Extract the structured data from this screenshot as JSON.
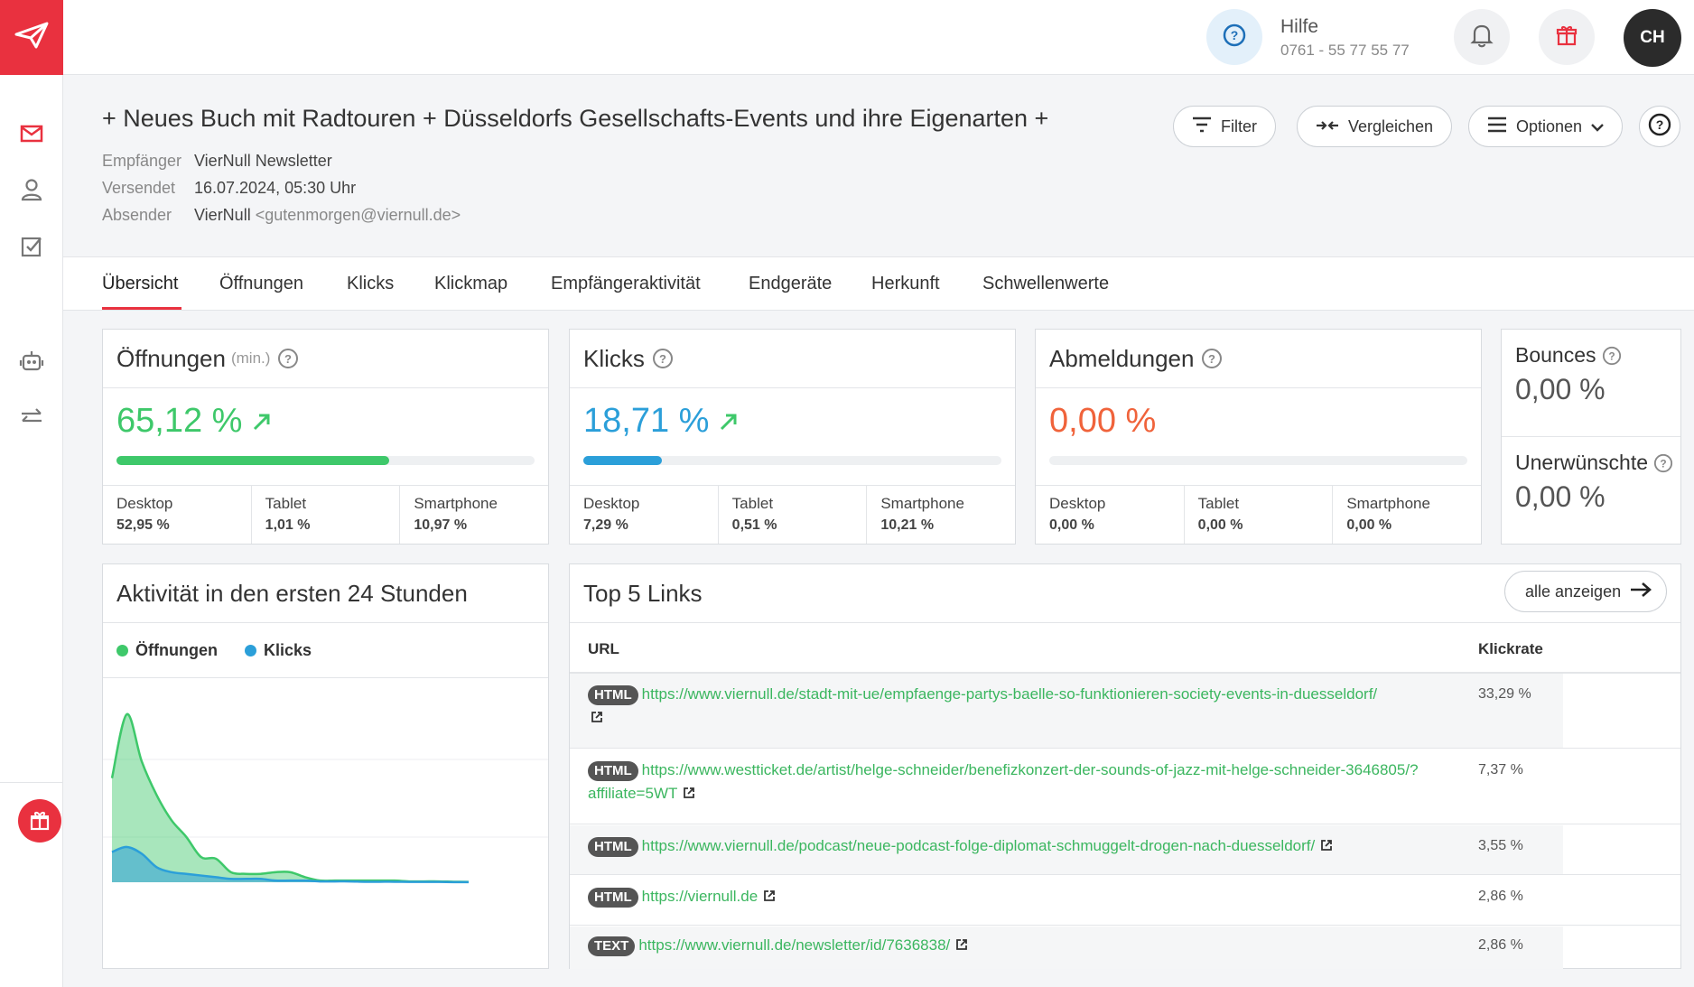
{
  "topbar": {
    "help_title": "Hilfe",
    "help_phone": "0761 - 55 77 55 77",
    "avatar_initials": "CH"
  },
  "header": {
    "title": "+ Neues Buch mit Radtouren + Düsseldorfs Gesellschafts-Events und ihre Eigenarten +",
    "recipient_label": "Empfänger",
    "recipient_value": "VierNull Newsletter",
    "sent_label": "Versendet",
    "sent_value": "16.07.2024, 05:30 Uhr",
    "sender_label": "Absender",
    "sender_name": "VierNull",
    "sender_email": "<gutenmorgen@viernull.de>",
    "filter_label": "Filter",
    "compare_label": "Vergleichen",
    "options_label": "Optionen"
  },
  "tabs": [
    "Übersicht",
    "Öffnungen",
    "Klicks",
    "Klickmap",
    "Empfängeraktivität",
    "Endgeräte",
    "Herkunft",
    "Schwellenwerte"
  ],
  "metrics": {
    "opens": {
      "title": "Öffnungen",
      "suffix": "(min.)",
      "value": "65,12 %",
      "fraction": 0.6512,
      "color": "#3ec86a",
      "devices": [
        {
          "label": "Desktop",
          "value": "52,95 %"
        },
        {
          "label": "Tablet",
          "value": "1,01 %"
        },
        {
          "label": "Smartphone",
          "value": "10,97 %"
        }
      ]
    },
    "clicks": {
      "title": "Klicks",
      "value": "18,71 %",
      "fraction": 0.1871,
      "color": "#2b9fd9",
      "devices": [
        {
          "label": "Desktop",
          "value": "7,29 %"
        },
        {
          "label": "Tablet",
          "value": "0,51 %"
        },
        {
          "label": "Smartphone",
          "value": "10,21 %"
        }
      ]
    },
    "unsubscribes": {
      "title": "Abmeldungen",
      "value": "0,00 %",
      "fraction": 0,
      "color": "#f0633b",
      "devices": [
        {
          "label": "Desktop",
          "value": "0,00 %"
        },
        {
          "label": "Tablet",
          "value": "0,00 %"
        },
        {
          "label": "Smartphone",
          "value": "0,00 %"
        }
      ]
    },
    "bounces": {
      "title": "Bounces",
      "value": "0,00 %"
    },
    "spam": {
      "title": "Unerwünschte",
      "value": "0,00 %"
    }
  },
  "activity": {
    "title": "Aktivität in den ersten 24 Stunden",
    "legend_opens": "Öffnungen",
    "legend_clicks": "Klicks",
    "opens_color": "#3ec86a",
    "clicks_color": "#2b9fd9"
  },
  "chart_data": {
    "type": "area",
    "x": [
      0,
      1,
      2,
      3,
      4,
      5,
      6,
      7,
      8,
      9,
      10,
      11,
      12,
      13,
      14,
      15,
      16,
      17,
      18,
      19,
      20,
      21,
      22,
      23,
      24
    ],
    "series": [
      {
        "name": "Öffnungen",
        "values": [
          62,
          100,
          72,
          52,
          37,
          27,
          15,
          14,
          6,
          5,
          5,
          6,
          6,
          3,
          1,
          1,
          1,
          1,
          1,
          1,
          0.5,
          0.5,
          0.5,
          0.3,
          0.2
        ]
      },
      {
        "name": "Klicks",
        "values": [
          18,
          21,
          17,
          9,
          6,
          5,
          4,
          3,
          2,
          2,
          2,
          1,
          1,
          1,
          0.5,
          0.5,
          0.5,
          0.3,
          0.3,
          0.3,
          0.2,
          0.2,
          0.2,
          0.1,
          0.1
        ]
      }
    ]
  },
  "links": {
    "title": "Top 5 Links",
    "all_label": "alle anzeigen",
    "col_url": "URL",
    "col_rate": "Klickrate",
    "rows": [
      {
        "type": "HTML",
        "url": "https://www.viernull.de/stadt-mit-ue/empfaenge-partys-baelle-so-funktionieren-society-events-in-duesseldorf/",
        "rate": "33,29 %"
      },
      {
        "type": "HTML",
        "url": "https://www.westticket.de/artist/helge-schneider/benefizkonzert-der-sounds-of-jazz-mit-helge-schneider-3646805/?affiliate=5WT",
        "rate": "7,37 %"
      },
      {
        "type": "HTML",
        "url": "https://www.viernull.de/podcast/neue-podcast-folge-diplomat-schmuggelt-drogen-nach-duesseldorf/",
        "rate": "3,55 %"
      },
      {
        "type": "HTML",
        "url": "https://viernull.de",
        "rate": "2,86 %"
      },
      {
        "type": "TEXT",
        "url": "https://www.viernull.de/newsletter/id/7636838/",
        "rate": "2,86 %"
      }
    ]
  }
}
